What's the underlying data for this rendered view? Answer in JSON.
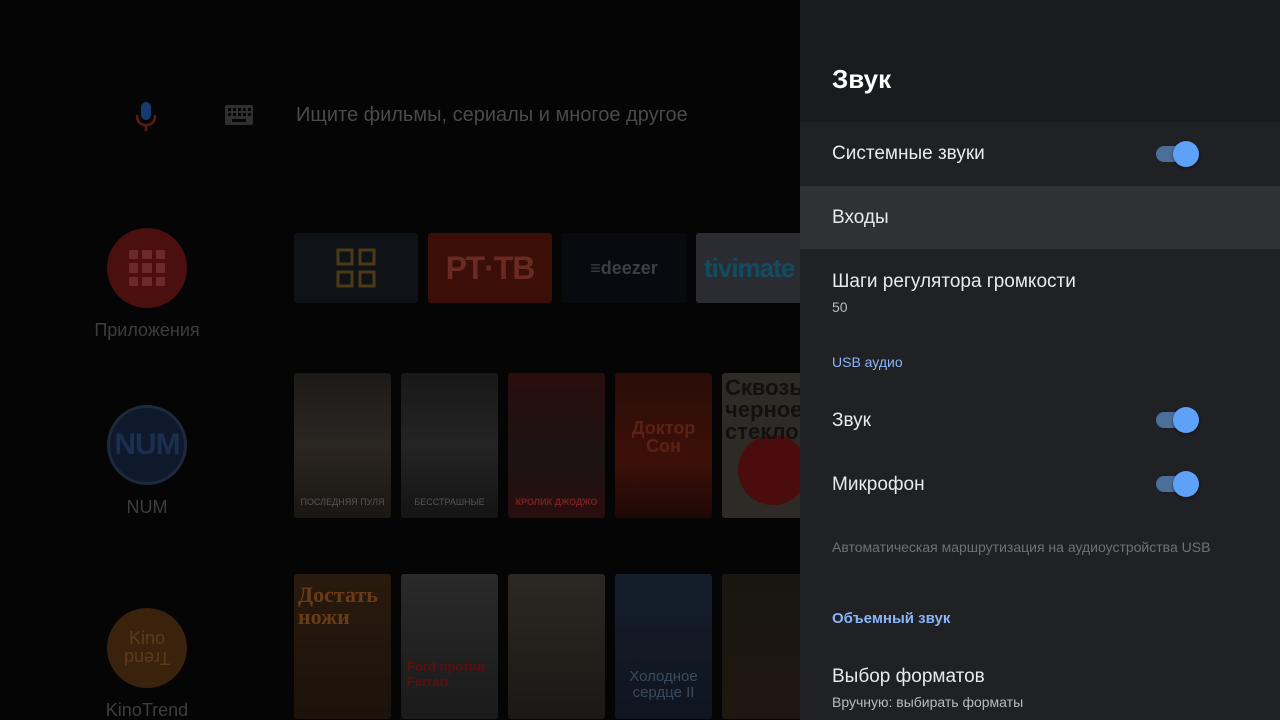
{
  "launcher": {
    "search_placeholder": "Ищите фильмы, сериалы и многое другое",
    "side_apps": [
      {
        "label": "Приложения"
      },
      {
        "label": "NUM",
        "logo": "NUM"
      },
      {
        "label": "KinoTrend",
        "logo_lines": [
          "Kino",
          "Trend"
        ]
      }
    ],
    "app_tiles": [
      {
        "name": "apps-grid"
      },
      {
        "name": "rttv",
        "logo": "РТ·ТВ"
      },
      {
        "name": "deezer",
        "logo": "≡deezer"
      },
      {
        "name": "tivimate",
        "logo": "tivimate"
      }
    ],
    "row1_posters": [
      {
        "title": "Последняя пуля"
      },
      {
        "title": "Бесстрашные"
      },
      {
        "title": "Кролик Джоджо"
      },
      {
        "title": "Доктор Сон"
      },
      {
        "title": "Сквозь черное стекло"
      }
    ],
    "row2_posters": [
      {
        "title": "Достать ножи"
      },
      {
        "title": "Ford против Ferrari"
      },
      {
        "title": ""
      },
      {
        "title": "Холодное сердце II"
      },
      {
        "title": ""
      }
    ]
  },
  "panel": {
    "title": "Звук",
    "items": [
      {
        "title": "Системные звуки",
        "toggle": true
      },
      {
        "title": "Входы",
        "focused": true
      },
      {
        "title": "Шаги регулятора громкости",
        "value": "50"
      }
    ],
    "usb_section": "USB аудио",
    "usb_items": [
      {
        "title": "Звук",
        "toggle": true
      },
      {
        "title": "Микрофон",
        "toggle": true
      }
    ],
    "usb_note": "Автоматическая маршрутизация на аудиоустройства USB",
    "surround_section": "Объемный звук",
    "surround_items": [
      {
        "title": "Выбор форматов",
        "value": "Вручную: выбирать форматы"
      }
    ]
  },
  "colors": {
    "accent": "#8ab4f8",
    "toggle_knob": "#5ea1f8",
    "toggle_track": "#4c6f99",
    "panel_bg": "#202124",
    "focused_bg": "#303134"
  }
}
